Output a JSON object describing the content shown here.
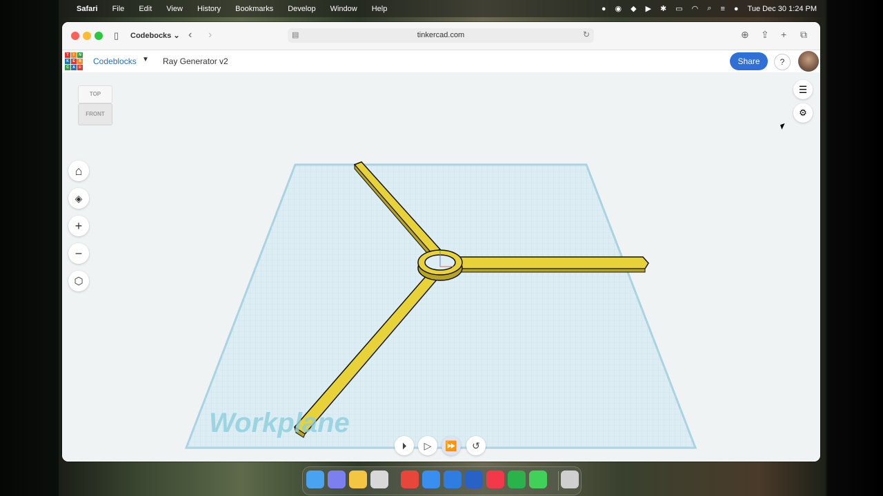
{
  "menubar": {
    "app_name": "Safari",
    "items": [
      "File",
      "Edit",
      "View",
      "History",
      "Bookmarks",
      "Develop",
      "Window",
      "Help"
    ],
    "datetime": "Tue Dec 30  1:24 PM"
  },
  "browser": {
    "tab_group_label": "Codebocks",
    "url": "tinkercad.com"
  },
  "app": {
    "logo_letters": [
      "T",
      "I",
      "N",
      "K",
      "E",
      "R",
      "C",
      "A",
      "D"
    ],
    "breadcrumb": "Codeblocks",
    "design_title": "Ray Generator v2",
    "share_label": "Share",
    "help_label": "?"
  },
  "viewcube": {
    "top_label": "TOP",
    "front_label": "FRONT"
  },
  "workplane": {
    "label": "Workplane"
  },
  "colors": {
    "share": "#2f6fd6",
    "shape": "#e8d23a",
    "shape_outline": "#1a1a1a",
    "plane": "#dcedf3"
  },
  "icons": {
    "nav": [
      "home-icon",
      "fit-view-icon",
      "zoom-in-icon",
      "zoom-out-icon",
      "perspective-icon"
    ],
    "right": [
      "blocks-panel-icon",
      "settings-sliders-icon"
    ],
    "playback": [
      "step-icon",
      "play-icon",
      "fast-forward-icon",
      "reset-icon"
    ]
  }
}
